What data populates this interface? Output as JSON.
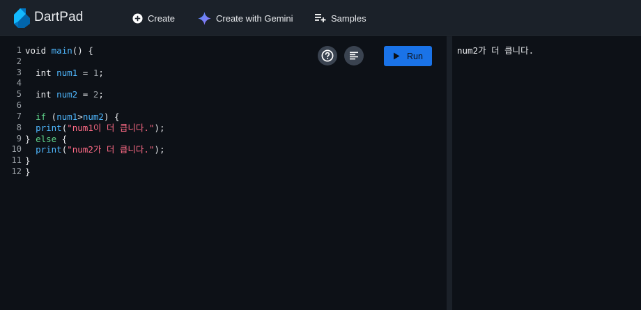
{
  "app": {
    "title": "DartPad"
  },
  "nav": {
    "create_label": "Create",
    "gemini_label": "Create with Gemini",
    "samples_label": "Samples"
  },
  "editor": {
    "run_label": "Run",
    "help_icon": "help-circle-icon",
    "format_icon": "format-align-icon",
    "line_numbers": [
      "1",
      "2",
      "3",
      "4",
      "5",
      "6",
      "7",
      "8",
      "9",
      "10",
      "11",
      "12"
    ]
  },
  "code": {
    "l1_void": "void",
    "l1_main": "main",
    "l1_rest": "() {",
    "l3_int": "int",
    "l3_var": "num1",
    "l3_eq": " = ",
    "l3_num": "1",
    "l3_semi": ";",
    "l5_int": "int",
    "l5_var": "num2",
    "l5_eq": " = ",
    "l5_num": "2",
    "l5_semi": ";",
    "l7_if": "if",
    "l7_open": " (",
    "l7_a": "num1",
    "l7_op": ">",
    "l7_b": "num2",
    "l7_close": ") {",
    "l8_print": "print",
    "l8_open": "(",
    "l8_str": "\"num1이 더 큽니다.\"",
    "l8_close": ");",
    "l9_brace": "} ",
    "l9_else": "else",
    "l9_open": " {",
    "l10_print": "print",
    "l10_open": "(",
    "l10_str": "\"num2가 더 큽니다.\"",
    "l10_close": ");",
    "l11": "}",
    "l12": "}"
  },
  "output": {
    "text": "num2가 더 큽니다."
  },
  "colors": {
    "accent": "#1a73e8",
    "topbar": "#1b2129",
    "background": "#0d1117",
    "keyword_green": "#5fd38a",
    "identifier_blue": "#4fb8ff",
    "string_pink": "#ff6b86"
  }
}
